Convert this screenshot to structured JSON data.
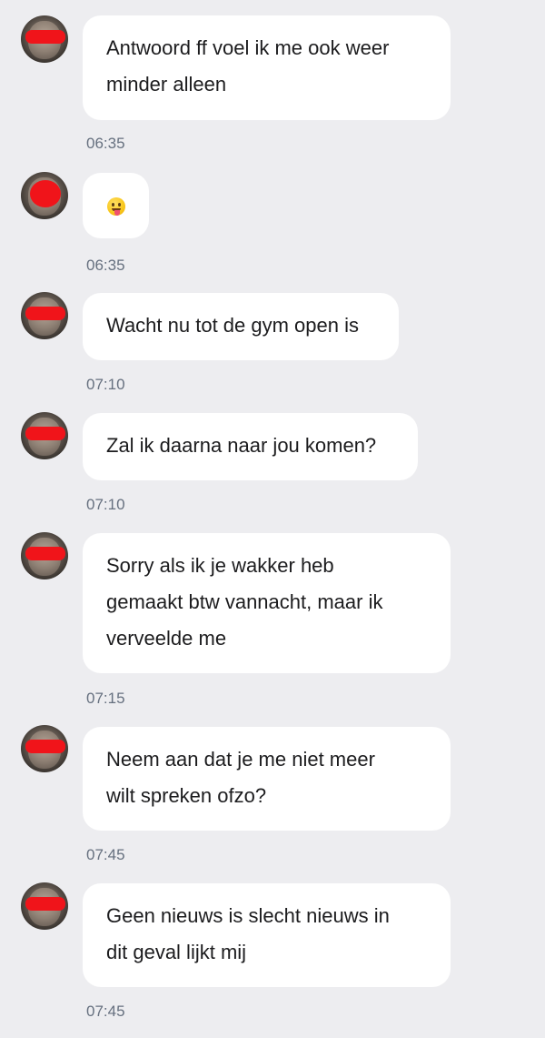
{
  "messages": [
    {
      "text": "Antwoord ff voel ik me ook weer\nminder alleen",
      "time": "06:35"
    },
    {
      "emoji": "stuck-out-tongue-emoji",
      "time": "06:35"
    },
    {
      "text": "Wacht nu tot de gym open is",
      "time": "07:10"
    },
    {
      "text": "Zal ik daarna naar jou komen?",
      "time": "07:10"
    },
    {
      "text": "Sorry als ik je wakker heb\ngemaakt btw vannacht, maar ik\nverveelde me",
      "time": "07:15"
    },
    {
      "text": "Neem aan dat je me niet meer\nwilt spreken ofzo?",
      "time": "07:45"
    },
    {
      "text": "Geen nieuws is slecht nieuws in\ndit geval lijkt mij",
      "time": "07:45"
    }
  ],
  "colors": {
    "background": "#ededf0",
    "bubble": "#ffffff",
    "text": "#1c1c1e",
    "timestamp": "#66707f",
    "redaction": "#f0141a"
  }
}
